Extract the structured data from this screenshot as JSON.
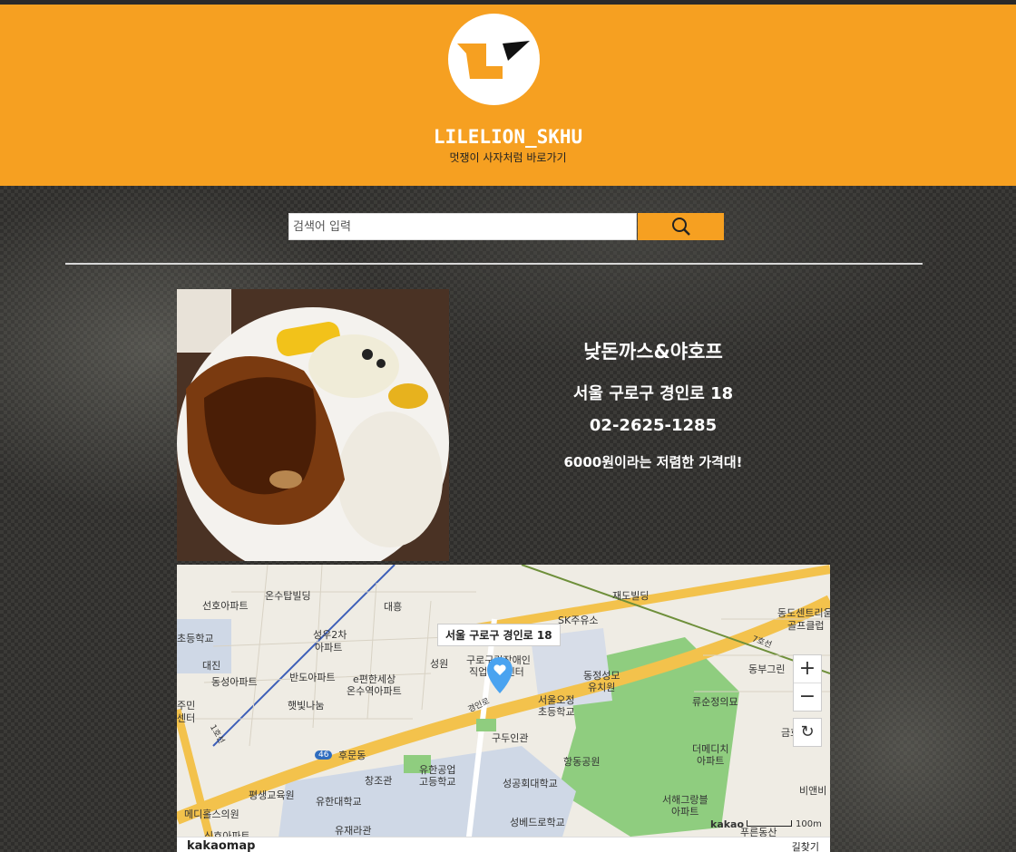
{
  "header": {
    "brand": "LILELION_SKHU",
    "tagline": "멋쟁이 사자처럼 바로가기"
  },
  "search": {
    "placeholder": "검색어 입력"
  },
  "restaurant": {
    "name": "낮돈까스&야호프",
    "address": "서울 구로구 경인로 18",
    "phone": "02-2625-1285",
    "description": "6000원이라는 저렴한 가격대!"
  },
  "map": {
    "marker_label": "서울 구로구 경인로 18",
    "zoom_in": "+",
    "zoom_out": "−",
    "reset": "↻",
    "brand": "kakaomap",
    "kakao": "kakao",
    "scale": "100m",
    "directions": "길찾기",
    "labels": [
      "재도빌딩",
      "동도센트리움",
      "골프클럽",
      "선호아파트",
      "온수탑빌딩",
      "대흥",
      "SK주유소",
      "초등학교",
      "성우2차",
      "아파트",
      "대진",
      "동성아파트",
      "반도아파트",
      "e편한세상",
      "온수역아파트",
      "성원",
      "구로구립장애인",
      "직업재활센터",
      "동정성모",
      "유치원",
      "동부그린",
      "햇빛나눔",
      "주민",
      "센터",
      "서울오정",
      "초등학교",
      "류순정의묘",
      "구두인관",
      "항동공원",
      "더메디치",
      "아파트",
      "후문동",
      "창조관",
      "유한공업",
      "고등학교",
      "성공회대학교",
      "평생교육원",
      "유한대학교",
      "서해그랑블",
      "아파트",
      "메디홀스의원",
      "비앤비",
      "유재라관",
      "성베드로학교",
      "푸른동산",
      "신호아파트",
      "금호"
    ],
    "road_labels": [
      "경인로",
      "1호선",
      "7호선",
      "46"
    ]
  },
  "colors": {
    "accent": "#f6a021",
    "marker": "#4aa3f0"
  }
}
